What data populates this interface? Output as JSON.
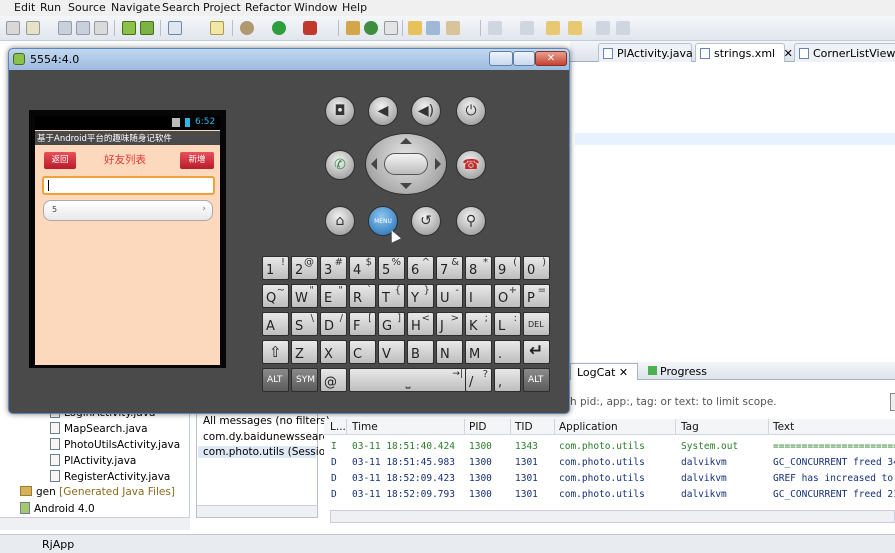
{
  "menu": [
    "Edit",
    "Run",
    "Source",
    "Navigate",
    "Search",
    "Project",
    "Refactor",
    "Window",
    "Help"
  ],
  "editor_tabs": [
    "PlActivity.java",
    "strings.xml",
    "CornerListView.java"
  ],
  "package_explorer": {
    "items": [
      "LoginActivity.java",
      "MapSearch.java",
      "PhotoUtilsActivity.java",
      "PlActivity.java",
      "RegisterActivity.java"
    ],
    "gen_label": "gen",
    "gen_suffix": "[Generated Java Files]",
    "android_label": "Android 4.0"
  },
  "bottom_tabs": {
    "logcat": "LogCat",
    "progress": "Progress"
  },
  "logcat": {
    "filter_hint": "h pid:, app:, tag: or text: to limit scope.",
    "filters": [
      "All messages (no filters)",
      "com.dy.baidunewssearch",
      "com.photo.utils (Session"
    ],
    "columns": [
      "L...",
      "Time",
      "PID",
      "TID",
      "Application",
      "Tag",
      "Text"
    ],
    "rows": [
      {
        "level": "I",
        "time": "03-11 18:51:40.424",
        "pid": "1300",
        "tid": "1343",
        "app": "com.photo.utils",
        "tag": "System.out",
        "text": "=========================="
      },
      {
        "level": "D",
        "time": "03-11 18:51:45.983",
        "pid": "1300",
        "tid": "1301",
        "app": "com.photo.utils",
        "tag": "dalvikvm",
        "text": "GC_CONCURRENT freed 34"
      },
      {
        "level": "D",
        "time": "03-11 18:52:09.423",
        "pid": "1300",
        "tid": "1301",
        "app": "com.photo.utils",
        "tag": "dalvikvm",
        "text": "GREF has increased to 2"
      },
      {
        "level": "D",
        "time": "03-11 18:52:09.793",
        "pid": "1300",
        "tid": "1301",
        "app": "com.photo.utils",
        "tag": "dalvikvm",
        "text": "GC_CONCURRENT freed 21"
      }
    ]
  },
  "status": {
    "project": "RjApp"
  },
  "emulator": {
    "title": "5554:4.0",
    "clock": "6:52",
    "app_title": "基于Android平台的趣味随身记软件",
    "back_button": "返回",
    "page_title": "好友列表",
    "add_button": "新增",
    "spinner_value": "5",
    "menu_key": "MENU",
    "keyboard": {
      "row1": [
        [
          "1",
          "!"
        ],
        [
          "2",
          "@"
        ],
        [
          "3",
          "#"
        ],
        [
          "4",
          "$"
        ],
        [
          "5",
          "%"
        ],
        [
          "6",
          "^"
        ],
        [
          "7",
          "&"
        ],
        [
          "8",
          "*"
        ],
        [
          "9",
          "("
        ],
        [
          "0",
          ")"
        ]
      ],
      "row2": [
        [
          "Q",
          "~"
        ],
        [
          "W",
          "\""
        ],
        [
          "E",
          "\""
        ],
        [
          "R",
          "`"
        ],
        [
          "T",
          "{"
        ],
        [
          "Y",
          "}"
        ],
        [
          "U",
          "-"
        ],
        [
          "I",
          ""
        ],
        [
          "O",
          "+"
        ],
        [
          "P",
          "="
        ]
      ],
      "row3": [
        [
          "A",
          ""
        ],
        [
          "S",
          "\\"
        ],
        [
          "D",
          "/"
        ],
        [
          "F",
          "["
        ],
        [
          "G",
          "]"
        ],
        [
          "H",
          "<"
        ],
        [
          "J",
          ">"
        ],
        [
          "K",
          ";"
        ],
        [
          "L",
          ":"
        ],
        [
          "DEL",
          ""
        ]
      ],
      "row4": [
        [
          "Z",
          ""
        ],
        [
          "X",
          ""
        ],
        [
          "C",
          ""
        ],
        [
          "V",
          ""
        ],
        [
          "B",
          ""
        ],
        [
          "N",
          ""
        ],
        [
          "M",
          ""
        ],
        [
          ".",
          ""
        ]
      ],
      "row5": [
        [
          "ALT",
          ""
        ],
        [
          "SYM",
          ""
        ],
        [
          "@",
          ""
        ],
        [
          "/",
          "?"
        ],
        [
          ",",
          ""
        ],
        [
          "ALT",
          ""
        ]
      ]
    }
  }
}
